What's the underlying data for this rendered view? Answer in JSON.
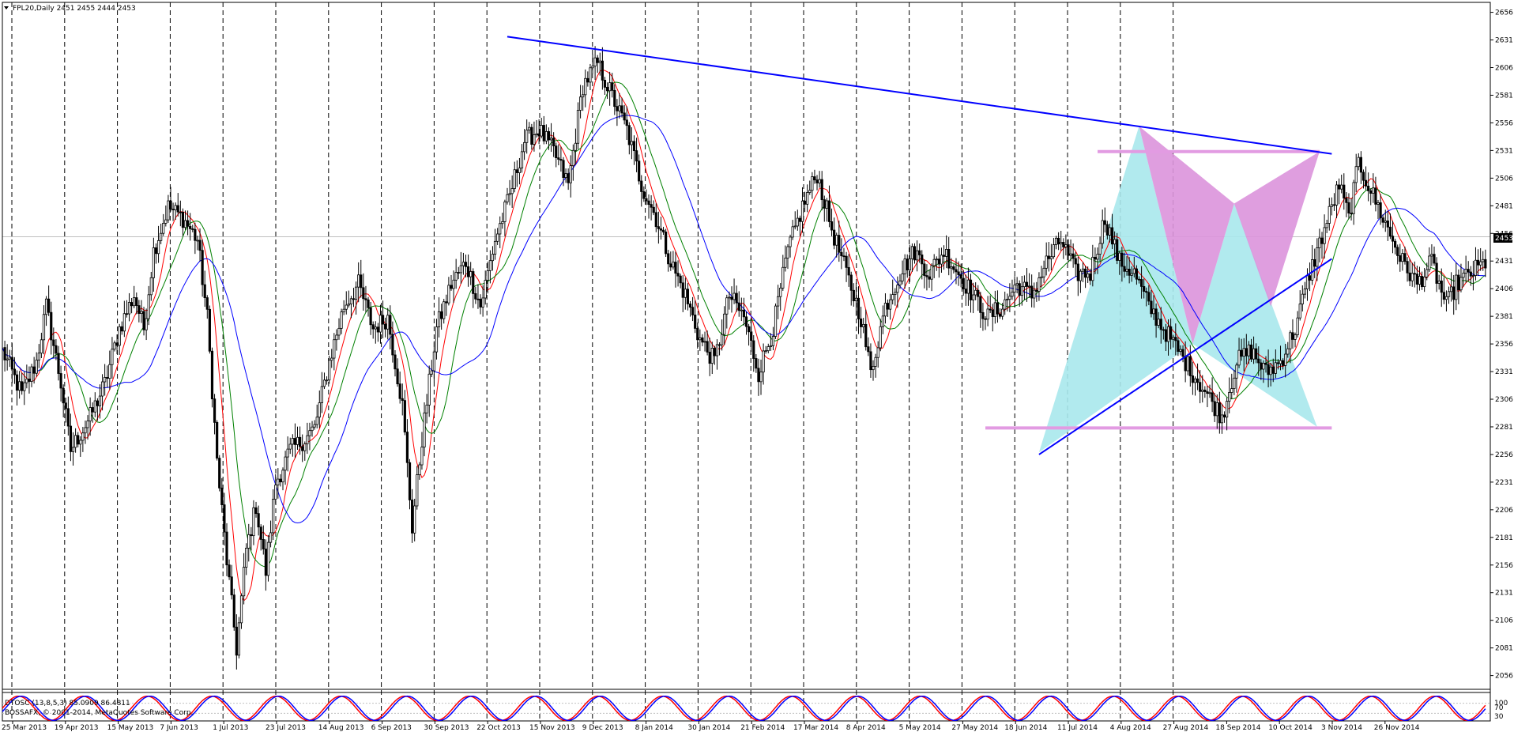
{
  "header": {
    "symbol_info": "FPL20,Daily  2451 2455 2444 2453"
  },
  "indicator": {
    "oscillator_info": "DTOSC (13,8,5,3) 85.0909 86.4811",
    "copyright": "BOSSAFX, © 2001-2014, MetaQuotes Software Corp.",
    "scale_labels": [
      "100",
      "70",
      "30"
    ]
  },
  "price_tag": "2453",
  "colors": {
    "background": "#ffffff",
    "candle": "#000000",
    "ma_fast": "#ff0000",
    "ma_mid": "#008000",
    "ma_slow": "#0000ff",
    "trendline": "#0000ff",
    "support_line": "#e29be2",
    "pattern_cyan": "#a8e8ec",
    "pattern_magenta": "#dc94dc",
    "osc_line_1": "#ff0000",
    "osc_line_2": "#0000ff",
    "price_tag_bg": "#000000"
  },
  "chart_data": {
    "type": "candlestick",
    "title": "FPL20,Daily",
    "ohlc_last": {
      "open": 2451,
      "high": 2455,
      "low": 2444,
      "close": 2453
    },
    "ylim": [
      2045,
      2665
    ],
    "y_ticks": [
      2656,
      2631,
      2606,
      2581,
      2556,
      2531,
      2506,
      2481,
      2456,
      2431,
      2406,
      2381,
      2356,
      2331,
      2306,
      2281,
      2256,
      2231,
      2206,
      2181,
      2156,
      2131,
      2106,
      2081,
      2056
    ],
    "x_tick_labels": [
      "25 Mar 2013",
      "19 Apr 2013",
      "15 May 2013",
      "7 Jun 2013",
      "1 Jul 2013",
      "23 Jul 2013",
      "14 Aug 2013",
      "6 Sep 2013",
      "30 Sep 2013",
      "22 Oct 2013",
      "15 Nov 2013",
      "9 Dec 2013",
      "8 Jan 2014",
      "30 Jan 2014",
      "21 Feb 2014",
      "17 Mar 2014",
      "8 Apr 2014",
      "5 May 2014",
      "27 May 2014",
      "18 Jun 2014",
      "11 Jul 2014",
      "4 Aug 2014",
      "27 Aug 2014",
      "18 Sep 2014",
      "10 Oct 2014",
      "3 Nov 2014",
      "26 Nov 2014"
    ],
    "separator_count": 23,
    "close_path": [
      {
        "x": 0,
        "y": 2350
      },
      {
        "x": 8,
        "y": 2310
      },
      {
        "x": 14,
        "y": 2340
      },
      {
        "x": 18,
        "y": 2390
      },
      {
        "x": 24,
        "y": 2320
      },
      {
        "x": 28,
        "y": 2260
      },
      {
        "x": 36,
        "y": 2290
      },
      {
        "x": 42,
        "y": 2320
      },
      {
        "x": 48,
        "y": 2370
      },
      {
        "x": 54,
        "y": 2400
      },
      {
        "x": 58,
        "y": 2370
      },
      {
        "x": 62,
        "y": 2440
      },
      {
        "x": 68,
        "y": 2480
      },
      {
        "x": 74,
        "y": 2470
      },
      {
        "x": 80,
        "y": 2450
      },
      {
        "x": 84,
        "y": 2380
      },
      {
        "x": 88,
        "y": 2250
      },
      {
        "x": 92,
        "y": 2160
      },
      {
        "x": 96,
        "y": 2080
      },
      {
        "x": 100,
        "y": 2170
      },
      {
        "x": 104,
        "y": 2210
      },
      {
        "x": 108,
        "y": 2150
      },
      {
        "x": 112,
        "y": 2230
      },
      {
        "x": 118,
        "y": 2260
      },
      {
        "x": 124,
        "y": 2270
      },
      {
        "x": 128,
        "y": 2280
      },
      {
        "x": 134,
        "y": 2340
      },
      {
        "x": 140,
        "y": 2390
      },
      {
        "x": 146,
        "y": 2410
      },
      {
        "x": 152,
        "y": 2370
      },
      {
        "x": 158,
        "y": 2380
      },
      {
        "x": 164,
        "y": 2300
      },
      {
        "x": 168,
        "y": 2190
      },
      {
        "x": 172,
        "y": 2270
      },
      {
        "x": 178,
        "y": 2370
      },
      {
        "x": 184,
        "y": 2410
      },
      {
        "x": 190,
        "y": 2430
      },
      {
        "x": 196,
        "y": 2390
      },
      {
        "x": 202,
        "y": 2450
      },
      {
        "x": 208,
        "y": 2490
      },
      {
        "x": 214,
        "y": 2540
      },
      {
        "x": 220,
        "y": 2550
      },
      {
        "x": 226,
        "y": 2530
      },
      {
        "x": 232,
        "y": 2500
      },
      {
        "x": 238,
        "y": 2590
      },
      {
        "x": 244,
        "y": 2610
      },
      {
        "x": 250,
        "y": 2580
      },
      {
        "x": 256,
        "y": 2550
      },
      {
        "x": 262,
        "y": 2500
      },
      {
        "x": 268,
        "y": 2470
      },
      {
        "x": 274,
        "y": 2430
      },
      {
        "x": 280,
        "y": 2400
      },
      {
        "x": 286,
        "y": 2360
      },
      {
        "x": 292,
        "y": 2340
      },
      {
        "x": 298,
        "y": 2400
      },
      {
        "x": 304,
        "y": 2380
      },
      {
        "x": 310,
        "y": 2330
      },
      {
        "x": 316,
        "y": 2370
      },
      {
        "x": 322,
        "y": 2440
      },
      {
        "x": 328,
        "y": 2480
      },
      {
        "x": 334,
        "y": 2510
      },
      {
        "x": 340,
        "y": 2460
      },
      {
        "x": 346,
        "y": 2420
      },
      {
        "x": 352,
        "y": 2380
      },
      {
        "x": 356,
        "y": 2330
      },
      {
        "x": 362,
        "y": 2390
      },
      {
        "x": 368,
        "y": 2420
      },
      {
        "x": 374,
        "y": 2440
      },
      {
        "x": 380,
        "y": 2420
      },
      {
        "x": 386,
        "y": 2440
      },
      {
        "x": 392,
        "y": 2420
      },
      {
        "x": 398,
        "y": 2400
      },
      {
        "x": 404,
        "y": 2380
      },
      {
        "x": 410,
        "y": 2390
      },
      {
        "x": 416,
        "y": 2410
      },
      {
        "x": 422,
        "y": 2400
      },
      {
        "x": 428,
        "y": 2430
      },
      {
        "x": 434,
        "y": 2450
      },
      {
        "x": 440,
        "y": 2420
      },
      {
        "x": 446,
        "y": 2420
      },
      {
        "x": 452,
        "y": 2470
      },
      {
        "x": 458,
        "y": 2430
      },
      {
        "x": 464,
        "y": 2420
      },
      {
        "x": 470,
        "y": 2390
      },
      {
        "x": 476,
        "y": 2370
      },
      {
        "x": 482,
        "y": 2350
      },
      {
        "x": 488,
        "y": 2330
      },
      {
        "x": 494,
        "y": 2310
      },
      {
        "x": 500,
        "y": 2290
      },
      {
        "x": 506,
        "y": 2340
      },
      {
        "x": 512,
        "y": 2350
      },
      {
        "x": 518,
        "y": 2330
      },
      {
        "x": 524,
        "y": 2340
      },
      {
        "x": 530,
        "y": 2370
      },
      {
        "x": 536,
        "y": 2420
      },
      {
        "x": 542,
        "y": 2460
      },
      {
        "x": 548,
        "y": 2500
      },
      {
        "x": 552,
        "y": 2470
      },
      {
        "x": 556,
        "y": 2520
      },
      {
        "x": 562,
        "y": 2490
      },
      {
        "x": 568,
        "y": 2460
      },
      {
        "x": 574,
        "y": 2430
      },
      {
        "x": 580,
        "y": 2410
      },
      {
        "x": 586,
        "y": 2430
      },
      {
        "x": 592,
        "y": 2390
      },
      {
        "x": 596,
        "y": 2410
      },
      {
        "x": 602,
        "y": 2420
      },
      {
        "x": 608,
        "y": 2430
      }
    ],
    "moving_averages": [
      {
        "name": "",
        "color": "#ff0000",
        "lag": 3
      },
      {
        "name": "",
        "color": "#008000",
        "lag": 7
      },
      {
        "name": "",
        "color": "#0000ff",
        "lag": 16
      }
    ],
    "trendlines": [
      {
        "from": {
          "x": 207,
          "y": 2634
        },
        "to": {
          "x": 545,
          "y": 2528
        },
        "color": "#0000ff"
      },
      {
        "from": {
          "x": 425,
          "y": 2256
        },
        "to": {
          "x": 545,
          "y": 2433
        },
        "color": "#0000ff"
      }
    ],
    "horizontal_levels": [
      {
        "value": 2530,
        "x_from": 449,
        "x_to": 540,
        "color": "#e29be2"
      },
      {
        "value": 2280,
        "x_from": 403,
        "x_to": 545,
        "color": "#e29be2"
      }
    ],
    "harmonic_patterns": [
      {
        "color": "#a8e8ec",
        "points": [
          {
            "x": 425,
            "y": 2258
          },
          {
            "x": 466,
            "y": 2553
          },
          {
            "x": 488,
            "y": 2356
          },
          {
            "x": 505,
            "y": 2483
          },
          {
            "x": 539,
            "y": 2281
          }
        ]
      },
      {
        "color": "#dc94dc",
        "points": [
          {
            "x": 466,
            "y": 2553
          },
          {
            "x": 488,
            "y": 2356
          },
          {
            "x": 505,
            "y": 2483
          },
          {
            "x": 520,
            "y": 2390
          },
          {
            "x": 540,
            "y": 2530
          }
        ]
      }
    ],
    "oscillator": {
      "name": "DTOSC (13,8,5,3)",
      "values": [
        85.0909,
        86.4811
      ],
      "ylim": [
        0,
        100
      ],
      "levels": [
        100,
        70,
        30
      ]
    }
  }
}
